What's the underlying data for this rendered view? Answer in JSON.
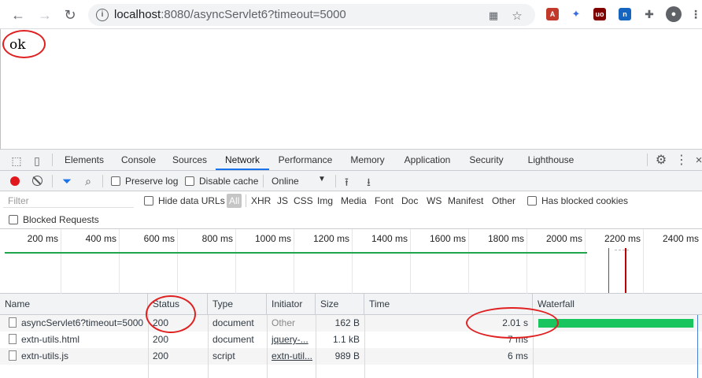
{
  "browser": {
    "url_host": "localhost",
    "url_path": ":8080/asyncServlet6?timeout=5000",
    "icons": [
      "back-icon",
      "forward-icon",
      "reload-icon",
      "site-info-icon",
      "qr-code-icon",
      "bookmark-star-icon",
      "pdf-extension-icon",
      "bird-extension-icon",
      "ublock-extension-icon",
      "tab-extension-icon",
      "extensions-puzzle-icon",
      "account-icon",
      "menu-icon"
    ]
  },
  "page": {
    "text": "ok"
  },
  "devtools": {
    "tabs": [
      "Elements",
      "Console",
      "Sources",
      "Network",
      "Performance",
      "Memory",
      "Application",
      "Security",
      "Lighthouse"
    ],
    "active_tab": "Network",
    "toolbar": {
      "preserve_log": "Preserve log",
      "disable_cache": "Disable cache",
      "throttling": "Online"
    },
    "filter": {
      "placeholder": "Filter",
      "hide_data_urls": "Hide data URLs",
      "types": [
        "All",
        "XHR",
        "JS",
        "CSS",
        "Img",
        "Media",
        "Font",
        "Doc",
        "WS",
        "Manifest",
        "Other"
      ],
      "has_blocked_cookies": "Has blocked cookies",
      "blocked_requests": "Blocked Requests"
    },
    "overview_ticks": [
      "200 ms",
      "400 ms",
      "600 ms",
      "800 ms",
      "1000 ms",
      "1200 ms",
      "1400 ms",
      "1600 ms",
      "1800 ms",
      "2000 ms",
      "2200 ms",
      "2400 ms"
    ],
    "table": {
      "headers": [
        "Name",
        "Status",
        "Type",
        "Initiator",
        "Size",
        "Time",
        "Waterfall"
      ],
      "rows": [
        {
          "name": "asyncServlet6?timeout=5000",
          "status": "200",
          "type": "document",
          "initiator": "Other",
          "size": "162 B",
          "time": "2.01 s"
        },
        {
          "name": "extn-utils.html",
          "status": "200",
          "type": "document",
          "initiator": "jquery-...",
          "size": "1.1 kB",
          "time": "7 ms"
        },
        {
          "name": "extn-utils.js",
          "status": "200",
          "type": "script",
          "initiator": "extn-util...",
          "size": "989 B",
          "time": "6 ms"
        }
      ]
    }
  },
  "colors": {
    "accent": "#1a73e8",
    "record": "#e0181e",
    "waterfall": "#18c55e",
    "annotation": "#e02020"
  }
}
